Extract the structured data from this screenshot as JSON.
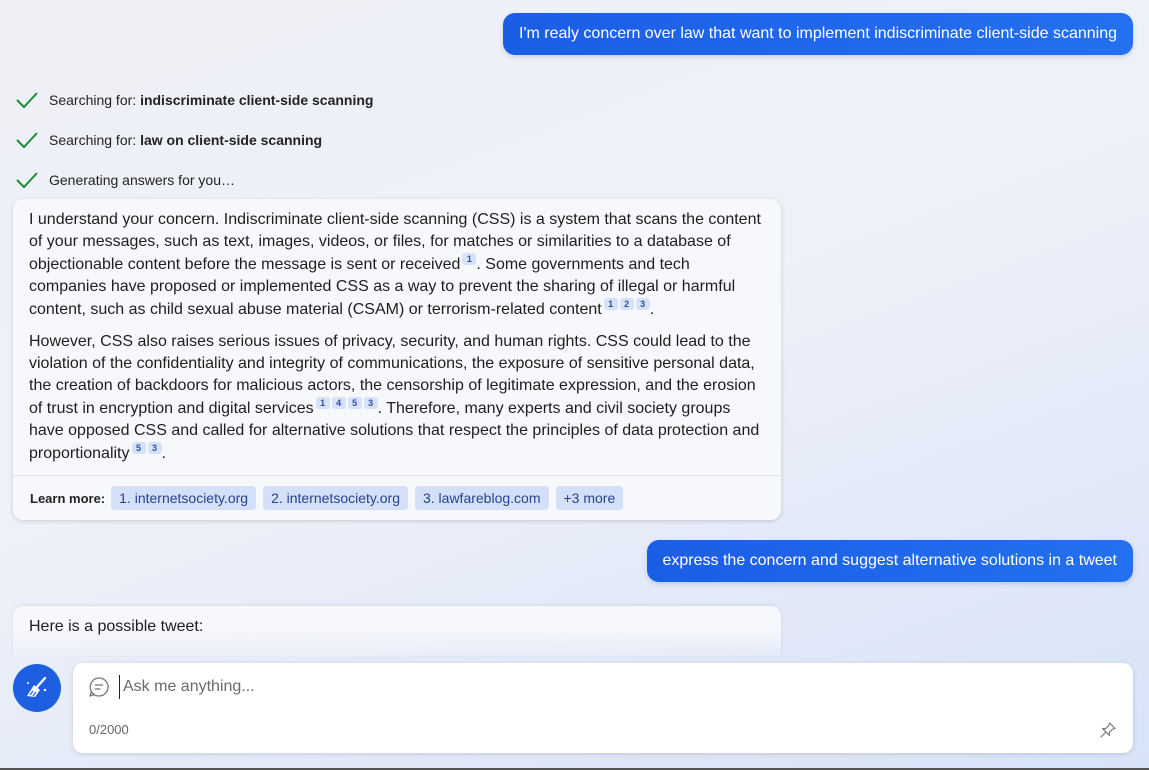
{
  "messages": {
    "user1": "I'm realy concern over law that want to implement indiscriminate client-side scanning",
    "user2": "express the concern and suggest alternative solutions in a tweet"
  },
  "status": {
    "s1_prefix": "Searching for: ",
    "s1_term": "indiscriminate client-side scanning",
    "s2_prefix": "Searching for: ",
    "s2_term": "law on client-side scanning",
    "s3": "Generating answers for you…"
  },
  "answer": {
    "p1_a": "I understand your concern. Indiscriminate client-side scanning (CSS) is a system that scans the content of your messages, such as text, images, videos, or files, for matches or similarities to a database of objectionable content before the message is sent or received",
    "p1_b": ". Some governments and tech companies have proposed or implemented CSS as a way to prevent the sharing of illegal or harmful content, such as child sexual abuse material (CSAM) or terrorism-related content",
    "p1_c": ".",
    "p2_a": "However, CSS also raises serious issues of privacy, security, and human rights. CSS could lead to the violation of the confidentiality and integrity of communications, the exposure of sensitive personal data, the creation of backdoors for malicious actors, the censorship of legitimate expression, and the erosion of trust in encryption and digital services",
    "p2_b": ". Therefore, many experts and civil society groups have opposed CSS and called for alternative solutions that respect the principles of data protection and proportionality",
    "p2_c": ".",
    "cites": [
      "1",
      "2",
      "3",
      "4",
      "5"
    ]
  },
  "learn_more": {
    "label": "Learn more:",
    "links": [
      "1. internetsociety.org",
      "2. internetsociety.org",
      "3. lawfareblog.com",
      "+3 more"
    ]
  },
  "partial_reply": "Here is a possible tweet:",
  "input": {
    "placeholder": "Ask me anything...",
    "counter": "0/2000"
  },
  "colors": {
    "accent": "#1d5fe0",
    "check": "#1a8a35",
    "chip_bg": "#d4e0f8"
  }
}
